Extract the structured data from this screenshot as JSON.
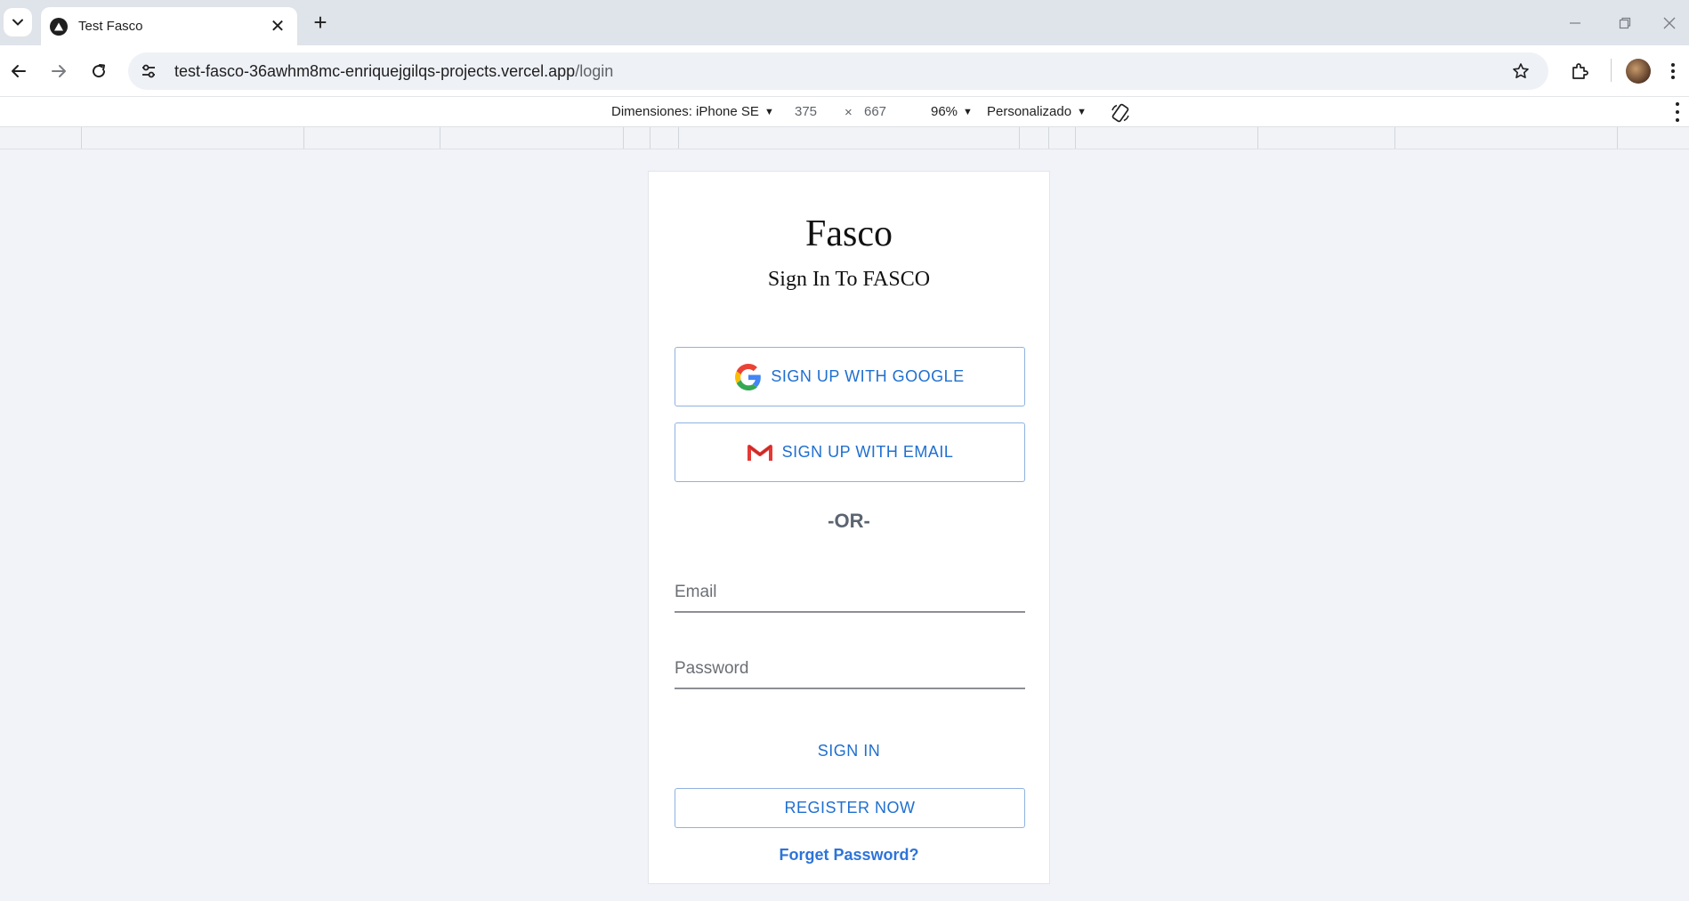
{
  "browser": {
    "tab": {
      "title": "Test Fasco",
      "close_glyph": "✕"
    },
    "new_tab_glyph": "+",
    "url": {
      "host": "test-fasco-36awhm8mc-enriquejgilqs-projects.vercel.app",
      "path": "/login"
    }
  },
  "devtools": {
    "device_label": "Dimensiones: iPhone SE",
    "width": "375",
    "times": "×",
    "height": "667",
    "zoom": "96%",
    "throttle": "Personalizado"
  },
  "page": {
    "brand": "Fasco",
    "subtitle": "Sign In To FASCO",
    "google_button": "SIGN UP WITH GOOGLE",
    "email_button": "SIGN UP WITH EMAIL",
    "or_divider": "-OR-",
    "email_placeholder": "Email",
    "password_placeholder": "Password",
    "sign_in": "SIGN IN",
    "register": "REGISTER NOW",
    "forgot": "Forget Password?"
  },
  "colors": {
    "accent": "#1f6fd0",
    "page_bg": "#f1f3f9",
    "tabstrip_bg": "#dfe3ea"
  },
  "icons": [
    "chevron-down-icon",
    "vercel-triangle-icon",
    "back-arrow-icon",
    "forward-arrow-icon",
    "reload-icon",
    "site-settings-icon",
    "star-icon",
    "extensions-icon",
    "google-g-icon",
    "gmail-icon",
    "rotate-icon"
  ]
}
